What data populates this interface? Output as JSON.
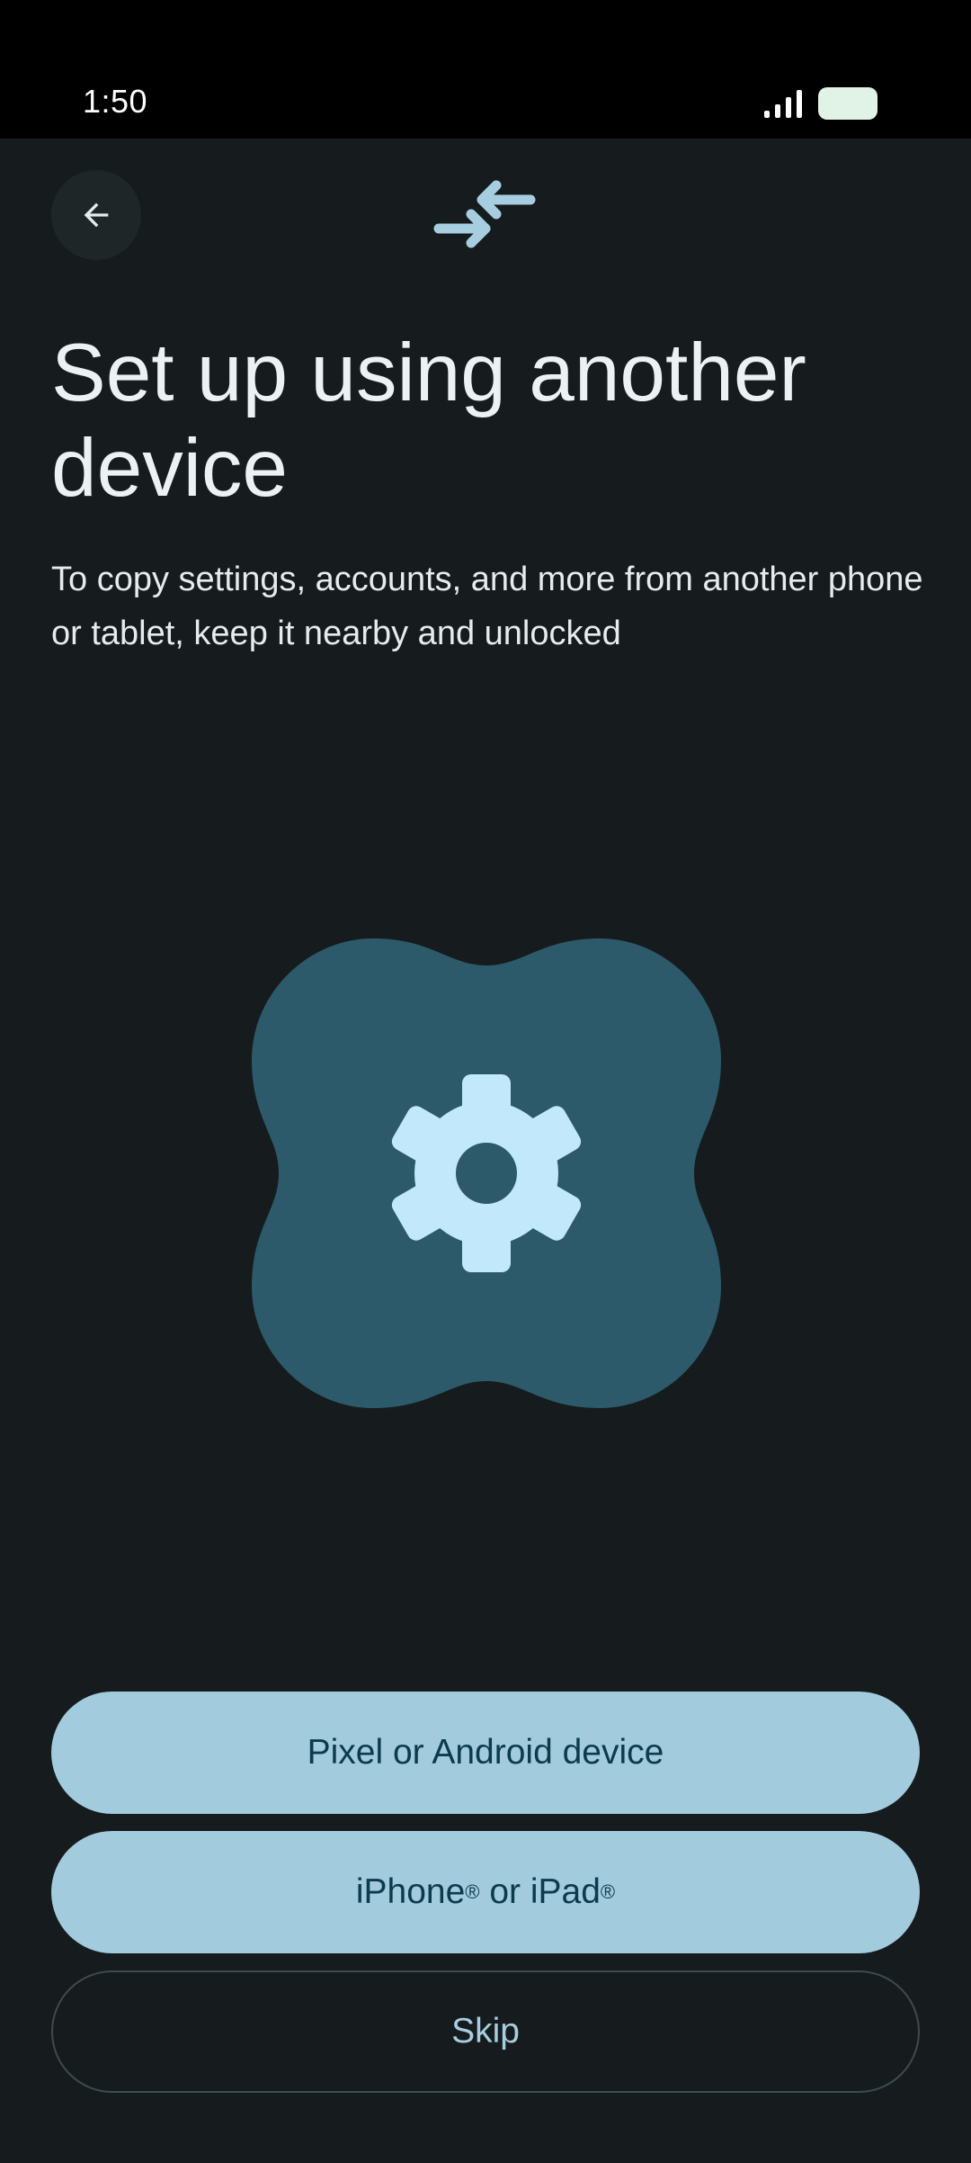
{
  "status_bar": {
    "time": "1:50"
  },
  "header": {
    "back_icon": "arrow-left-icon",
    "transfer_icon": "arrows-converge-icon"
  },
  "content": {
    "title": "Set up using another device",
    "subtitle": "To copy settings, accounts, and more from another phone or tablet, keep it nearby and unlocked"
  },
  "illustration": {
    "icon": "gear-icon",
    "shape_color": "#2c5a6a",
    "gear_color": "#c2e9fb"
  },
  "buttons": {
    "pixel_android": "Pixel or Android device",
    "iphone_label": "iPhone",
    "ipad_label": "iPad",
    "or_word": " or ",
    "registered_mark": "®",
    "skip": "Skip"
  },
  "colors": {
    "background": "#161b1d",
    "primary_button": "#a2cbdd",
    "primary_button_text": "#0c3a4e",
    "accent": "#a6cde0"
  }
}
